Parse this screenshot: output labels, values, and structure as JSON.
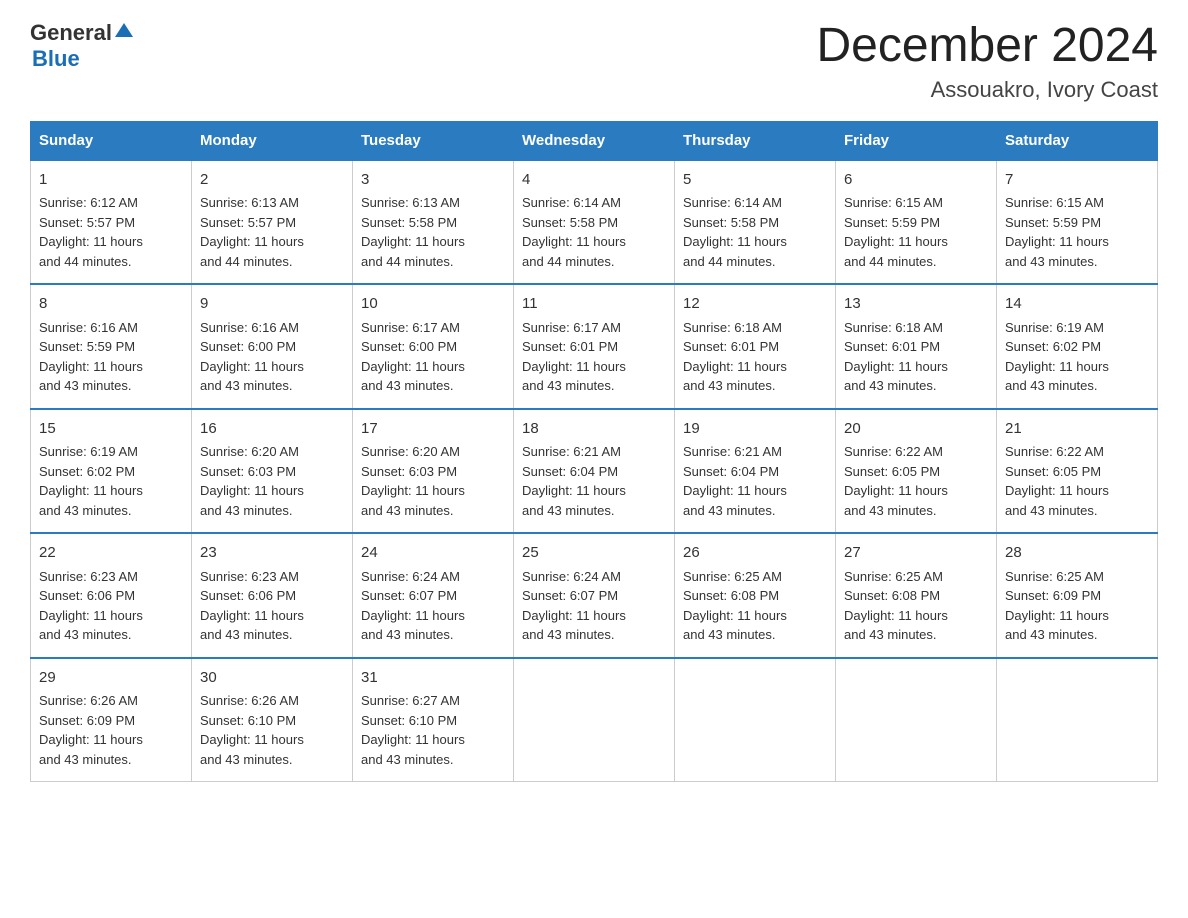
{
  "logo": {
    "line1": "General",
    "triangle": "▶",
    "line2": "Blue"
  },
  "header": {
    "month": "December 2024",
    "location": "Assouakro, Ivory Coast"
  },
  "days_of_week": [
    "Sunday",
    "Monday",
    "Tuesday",
    "Wednesday",
    "Thursday",
    "Friday",
    "Saturday"
  ],
  "weeks": [
    [
      {
        "day": "1",
        "sunrise": "6:12 AM",
        "sunset": "5:57 PM",
        "daylight": "11 hours and 44 minutes."
      },
      {
        "day": "2",
        "sunrise": "6:13 AM",
        "sunset": "5:57 PM",
        "daylight": "11 hours and 44 minutes."
      },
      {
        "day": "3",
        "sunrise": "6:13 AM",
        "sunset": "5:58 PM",
        "daylight": "11 hours and 44 minutes."
      },
      {
        "day": "4",
        "sunrise": "6:14 AM",
        "sunset": "5:58 PM",
        "daylight": "11 hours and 44 minutes."
      },
      {
        "day": "5",
        "sunrise": "6:14 AM",
        "sunset": "5:58 PM",
        "daylight": "11 hours and 44 minutes."
      },
      {
        "day": "6",
        "sunrise": "6:15 AM",
        "sunset": "5:59 PM",
        "daylight": "11 hours and 44 minutes."
      },
      {
        "day": "7",
        "sunrise": "6:15 AM",
        "sunset": "5:59 PM",
        "daylight": "11 hours and 43 minutes."
      }
    ],
    [
      {
        "day": "8",
        "sunrise": "6:16 AM",
        "sunset": "5:59 PM",
        "daylight": "11 hours and 43 minutes."
      },
      {
        "day": "9",
        "sunrise": "6:16 AM",
        "sunset": "6:00 PM",
        "daylight": "11 hours and 43 minutes."
      },
      {
        "day": "10",
        "sunrise": "6:17 AM",
        "sunset": "6:00 PM",
        "daylight": "11 hours and 43 minutes."
      },
      {
        "day": "11",
        "sunrise": "6:17 AM",
        "sunset": "6:01 PM",
        "daylight": "11 hours and 43 minutes."
      },
      {
        "day": "12",
        "sunrise": "6:18 AM",
        "sunset": "6:01 PM",
        "daylight": "11 hours and 43 minutes."
      },
      {
        "day": "13",
        "sunrise": "6:18 AM",
        "sunset": "6:01 PM",
        "daylight": "11 hours and 43 minutes."
      },
      {
        "day": "14",
        "sunrise": "6:19 AM",
        "sunset": "6:02 PM",
        "daylight": "11 hours and 43 minutes."
      }
    ],
    [
      {
        "day": "15",
        "sunrise": "6:19 AM",
        "sunset": "6:02 PM",
        "daylight": "11 hours and 43 minutes."
      },
      {
        "day": "16",
        "sunrise": "6:20 AM",
        "sunset": "6:03 PM",
        "daylight": "11 hours and 43 minutes."
      },
      {
        "day": "17",
        "sunrise": "6:20 AM",
        "sunset": "6:03 PM",
        "daylight": "11 hours and 43 minutes."
      },
      {
        "day": "18",
        "sunrise": "6:21 AM",
        "sunset": "6:04 PM",
        "daylight": "11 hours and 43 minutes."
      },
      {
        "day": "19",
        "sunrise": "6:21 AM",
        "sunset": "6:04 PM",
        "daylight": "11 hours and 43 minutes."
      },
      {
        "day": "20",
        "sunrise": "6:22 AM",
        "sunset": "6:05 PM",
        "daylight": "11 hours and 43 minutes."
      },
      {
        "day": "21",
        "sunrise": "6:22 AM",
        "sunset": "6:05 PM",
        "daylight": "11 hours and 43 minutes."
      }
    ],
    [
      {
        "day": "22",
        "sunrise": "6:23 AM",
        "sunset": "6:06 PM",
        "daylight": "11 hours and 43 minutes."
      },
      {
        "day": "23",
        "sunrise": "6:23 AM",
        "sunset": "6:06 PM",
        "daylight": "11 hours and 43 minutes."
      },
      {
        "day": "24",
        "sunrise": "6:24 AM",
        "sunset": "6:07 PM",
        "daylight": "11 hours and 43 minutes."
      },
      {
        "day": "25",
        "sunrise": "6:24 AM",
        "sunset": "6:07 PM",
        "daylight": "11 hours and 43 minutes."
      },
      {
        "day": "26",
        "sunrise": "6:25 AM",
        "sunset": "6:08 PM",
        "daylight": "11 hours and 43 minutes."
      },
      {
        "day": "27",
        "sunrise": "6:25 AM",
        "sunset": "6:08 PM",
        "daylight": "11 hours and 43 minutes."
      },
      {
        "day": "28",
        "sunrise": "6:25 AM",
        "sunset": "6:09 PM",
        "daylight": "11 hours and 43 minutes."
      }
    ],
    [
      {
        "day": "29",
        "sunrise": "6:26 AM",
        "sunset": "6:09 PM",
        "daylight": "11 hours and 43 minutes."
      },
      {
        "day": "30",
        "sunrise": "6:26 AM",
        "sunset": "6:10 PM",
        "daylight": "11 hours and 43 minutes."
      },
      {
        "day": "31",
        "sunrise": "6:27 AM",
        "sunset": "6:10 PM",
        "daylight": "11 hours and 43 minutes."
      },
      null,
      null,
      null,
      null
    ]
  ],
  "labels": {
    "sunrise": "Sunrise:",
    "sunset": "Sunset:",
    "daylight": "Daylight:"
  }
}
